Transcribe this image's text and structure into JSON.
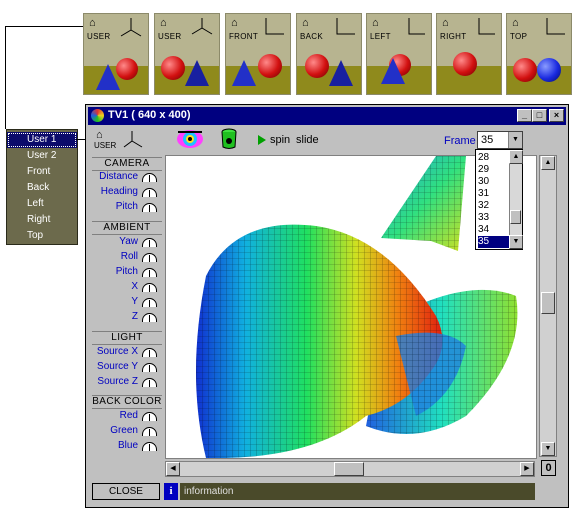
{
  "thumbnails": [
    {
      "label": "USER"
    },
    {
      "label": "USER"
    },
    {
      "label": "FRONT"
    },
    {
      "label": "BACK"
    },
    {
      "label": "LEFT"
    },
    {
      "label": "RIGHT"
    },
    {
      "label": "TOP"
    }
  ],
  "view_menu": {
    "items": [
      "User 1",
      "User 2",
      "Front",
      "Back",
      "Left",
      "Right",
      "Top"
    ],
    "selected": "User 1"
  },
  "window": {
    "title": "TV1 ( 640 x 400)",
    "toolbar": {
      "user_label": "USER",
      "spin_label": "spin",
      "slide_label": "slide"
    },
    "frame": {
      "label": "Frame",
      "value": "35",
      "options": [
        "28",
        "29",
        "30",
        "31",
        "32",
        "33",
        "34",
        "35"
      ]
    },
    "panel": {
      "camera": {
        "title": "CAMERA",
        "params": [
          "Distance",
          "Heading",
          "Pitch"
        ]
      },
      "ambient": {
        "title": "AMBIENT",
        "params": [
          "Yaw",
          "Roll",
          "Pitch",
          "X",
          "Y",
          "Z"
        ]
      },
      "light": {
        "title": "LIGHT",
        "params": [
          "Source X",
          "Source Y",
          "Source Z"
        ]
      },
      "back_color": {
        "title": "BACK COLOR",
        "params": [
          "Red",
          "Green",
          "Blue"
        ]
      }
    },
    "zero_button": "0",
    "close_button": "CLOSE",
    "info_icon": "i",
    "info_text": "information"
  }
}
